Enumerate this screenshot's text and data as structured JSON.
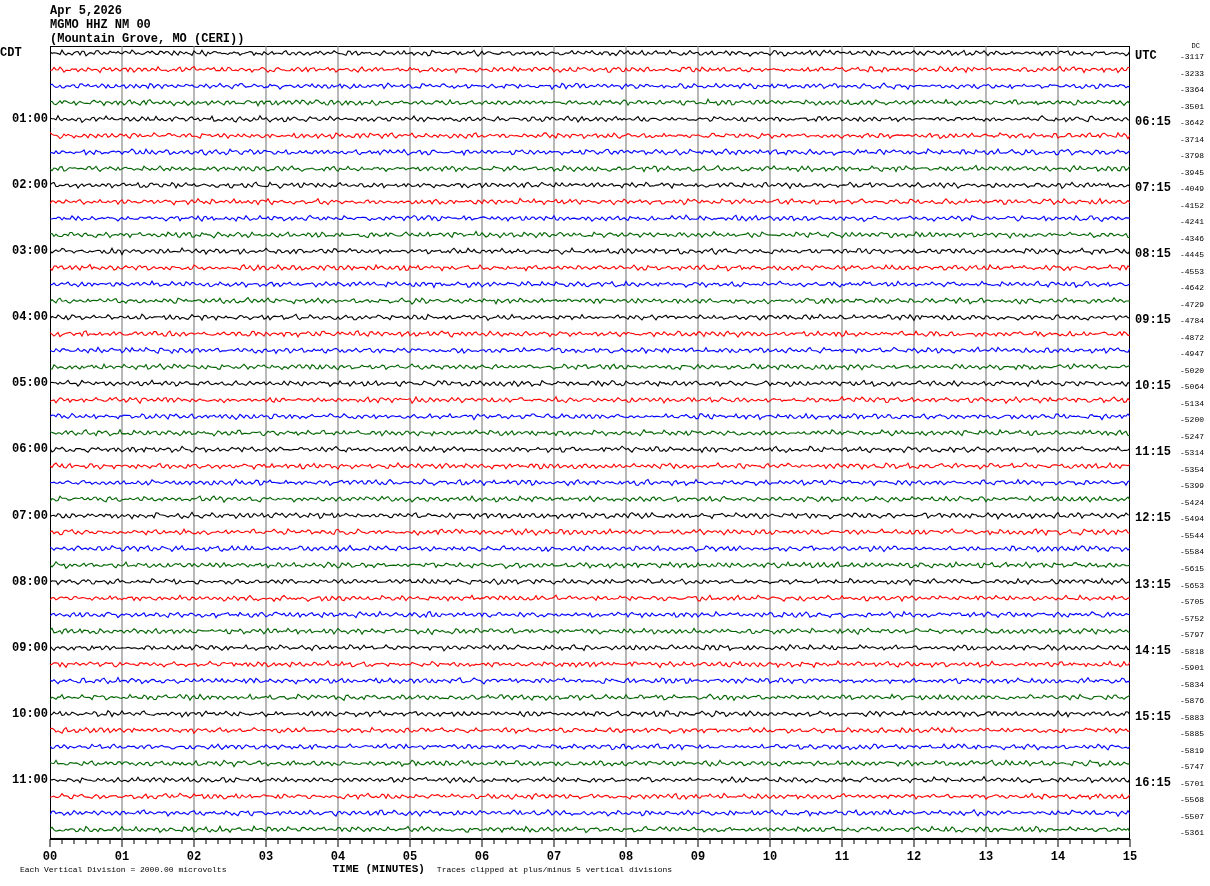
{
  "header": {
    "date": "Apr 5,2026",
    "station": "MGMO HHZ NM 00",
    "location": "(Mountain Grove, MO (CERI))"
  },
  "left_zone": "CDT",
  "right_zone": "UTC",
  "dc_label": "DC",
  "hours": [
    {
      "traces": [
        {
          "color": "#000000",
          "dc": "-3117"
        },
        {
          "color": "#ff0000",
          "dc": "-3233"
        },
        {
          "color": "#0000ff",
          "dc": "-3364"
        },
        {
          "color": "#006400",
          "dc": "-3501"
        }
      ]
    },
    {
      "local": "01:00",
      "utc": "06:15",
      "traces": [
        {
          "color": "#000000",
          "dc": "-3642"
        },
        {
          "color": "#ff0000",
          "dc": "-3714"
        },
        {
          "color": "#0000ff",
          "dc": "-3798"
        },
        {
          "color": "#006400",
          "dc": "-3945"
        }
      ]
    },
    {
      "local": "02:00",
      "utc": "07:15",
      "traces": [
        {
          "color": "#000000",
          "dc": "-4049"
        },
        {
          "color": "#ff0000",
          "dc": "-4152"
        },
        {
          "color": "#0000ff",
          "dc": "-4241"
        },
        {
          "color": "#006400",
          "dc": "-4346"
        }
      ]
    },
    {
      "local": "03:00",
      "utc": "08:15",
      "traces": [
        {
          "color": "#000000",
          "dc": "-4445"
        },
        {
          "color": "#ff0000",
          "dc": "-4553"
        },
        {
          "color": "#0000ff",
          "dc": "-4642"
        },
        {
          "color": "#006400",
          "dc": "-4729"
        }
      ]
    },
    {
      "local": "04:00",
      "utc": "09:15",
      "traces": [
        {
          "color": "#000000",
          "dc": "-4784"
        },
        {
          "color": "#ff0000",
          "dc": "-4872"
        },
        {
          "color": "#0000ff",
          "dc": "-4947"
        },
        {
          "color": "#006400",
          "dc": "-5020"
        }
      ]
    },
    {
      "local": "05:00",
      "utc": "10:15",
      "traces": [
        {
          "color": "#000000",
          "dc": "-5064"
        },
        {
          "color": "#ff0000",
          "dc": "-5134"
        },
        {
          "color": "#0000ff",
          "dc": "-5200"
        },
        {
          "color": "#006400",
          "dc": "-5247"
        }
      ]
    },
    {
      "local": "06:00",
      "utc": "11:15",
      "traces": [
        {
          "color": "#000000",
          "dc": "-5314"
        },
        {
          "color": "#ff0000",
          "dc": "-5354"
        },
        {
          "color": "#0000ff",
          "dc": "-5399"
        },
        {
          "color": "#006400",
          "dc": "-5424"
        }
      ]
    },
    {
      "local": "07:00",
      "utc": "12:15",
      "traces": [
        {
          "color": "#000000",
          "dc": "-5494"
        },
        {
          "color": "#ff0000",
          "dc": "-5544"
        },
        {
          "color": "#0000ff",
          "dc": "-5584"
        },
        {
          "color": "#006400",
          "dc": "-5615"
        }
      ]
    },
    {
      "local": "08:00",
      "utc": "13:15",
      "traces": [
        {
          "color": "#000000",
          "dc": "-5653"
        },
        {
          "color": "#ff0000",
          "dc": "-5705"
        },
        {
          "color": "#0000ff",
          "dc": "-5752"
        },
        {
          "color": "#006400",
          "dc": "-5797"
        }
      ]
    },
    {
      "local": "09:00",
      "utc": "14:15",
      "traces": [
        {
          "color": "#000000",
          "dc": "-5818"
        },
        {
          "color": "#ff0000",
          "dc": "-5901"
        },
        {
          "color": "#0000ff",
          "dc": "-5834"
        },
        {
          "color": "#006400",
          "dc": "-5876"
        }
      ]
    },
    {
      "local": "10:00",
      "utc": "15:15",
      "traces": [
        {
          "color": "#000000",
          "dc": "-5883"
        },
        {
          "color": "#ff0000",
          "dc": "-5885"
        },
        {
          "color": "#0000ff",
          "dc": "-5819"
        },
        {
          "color": "#006400",
          "dc": "-5747"
        }
      ]
    },
    {
      "local": "11:00",
      "utc": "16:15",
      "traces": [
        {
          "color": "#000000",
          "dc": "-5701"
        },
        {
          "color": "#ff0000",
          "dc": "-5568"
        },
        {
          "color": "#0000ff",
          "dc": "-5507"
        },
        {
          "color": "#006400",
          "dc": "-5361"
        }
      ]
    }
  ],
  "x_axis": {
    "labels": [
      "00",
      "01",
      "02",
      "03",
      "04",
      "05",
      "06",
      "07",
      "08",
      "09",
      "10",
      "11",
      "12",
      "13",
      "14",
      "15"
    ],
    "title": "TIME (MINUTES)"
  },
  "notes": {
    "scale": "Each Vertical Division = 2000.00 microvolts",
    "clipping": "Traces clipped at plus/minus 5 vertical divisions"
  }
}
